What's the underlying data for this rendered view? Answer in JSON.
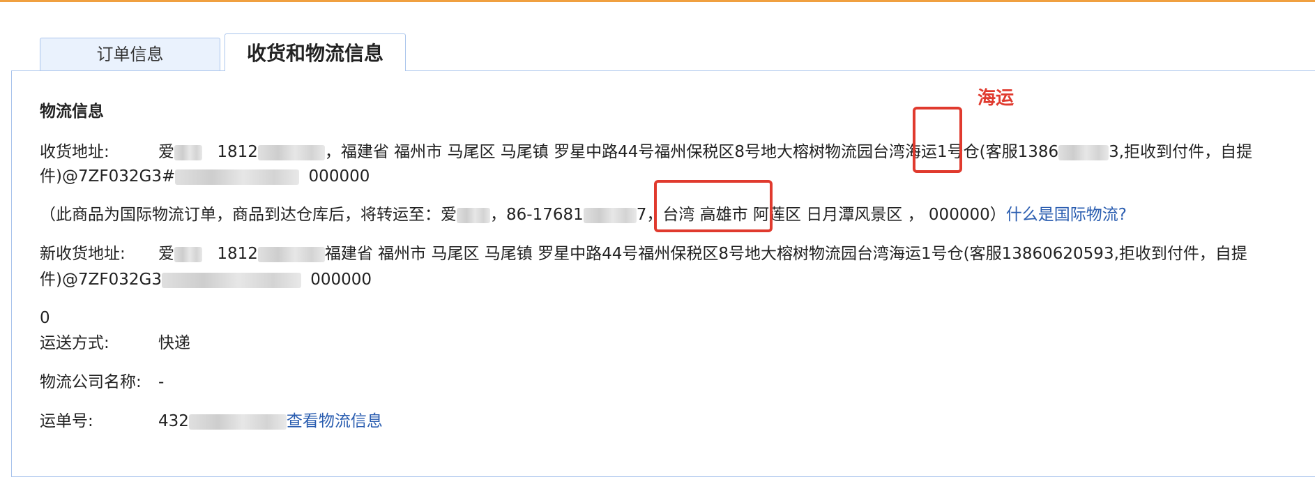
{
  "tabs": [
    {
      "label": "订单信息",
      "active": false
    },
    {
      "label": "收货和物流信息",
      "active": true
    }
  ],
  "logistics": {
    "section_title": "物流信息",
    "shipping_address": {
      "label": "收货地址:",
      "recipient": "爱",
      "phone": "1812",
      "line1": "，福建省 福州市 马尾区 马尾镇 罗星中路44号福州保税区8号地大榕树物流园台湾海运1号仓(客服1386",
      "line1_end": "3,拒收到付件，自提",
      "line2_start": "件)@7ZF032G3#",
      "postcode": "000000"
    },
    "notice": {
      "prefix": "（此商品为国际物流订单，商品到达仓库后，将转运至：爱",
      "phone": "，86-17681",
      "tail": "7，台湾 高雄市 阿莲区 日月潭风景区 ， 000000）",
      "link": "什么是国际物流?"
    },
    "new_address": {
      "label": "新收货地址:",
      "recipient": "爱",
      "phone": "1812",
      "line1": "福建省 福州市 马尾区 马尾镇 罗星中路44号福州保税区8号地大榕树物流园台湾海运1号仓(客服13860620593,拒收到付件，自提",
      "line2_start": "件)@7ZF032G3",
      "postcode": "000000"
    },
    "zero_value": "0",
    "shipping_method": {
      "label": "运送方式:",
      "value": "快递"
    },
    "company": {
      "label": "物流公司名称:",
      "value": "-"
    },
    "tracking": {
      "label": "运单号:",
      "value": "432",
      "link": "查看物流信息"
    }
  },
  "annotation": {
    "label": "海运",
    "color": "#e03a2e"
  },
  "colors": {
    "accent_top": "#f0a040",
    "tab_border": "#a9c4ec",
    "link": "#2a5db0"
  }
}
